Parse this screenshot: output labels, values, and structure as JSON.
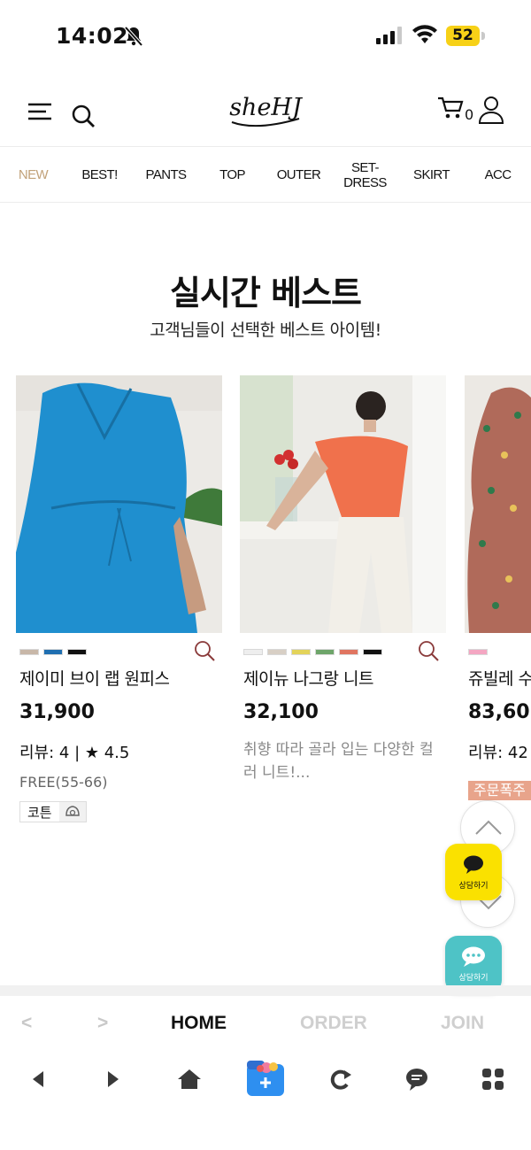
{
  "status_bar": {
    "time": "14:02",
    "battery": "52",
    "battery_color": "#f7d117"
  },
  "header": {
    "logo_text": "sheHJ",
    "cart_count": "0",
    "icons": [
      "menu-icon",
      "search-icon",
      "cart-icon",
      "user-icon"
    ]
  },
  "categories": [
    "NEW",
    "BEST!",
    "PANTS",
    "TOP",
    "OUTER",
    "SET-DRESS",
    "SKIRT",
    "ACC"
  ],
  "section": {
    "title": "실시간 베스트",
    "subtitle": "고객님들이 선택한 베스트 아이템!"
  },
  "products": [
    {
      "name": "제이미 브이 랩 원피스",
      "price": "31,900",
      "review": "리뷰: 4 | ★ 4.5",
      "size": "FREE(55-66)",
      "material": "코튼",
      "swatches": [
        "#c8b7a8",
        "#1f6fb1",
        "#111111"
      ]
    },
    {
      "name": "제이뉴 나그랑 니트",
      "price": "32,100",
      "description": "취향 따라 골라 입는 다양한 컬러 니트!...",
      "swatches": [
        "#eeeeee",
        "#d8cfc5",
        "#e3d35a",
        "#6ea56a",
        "#e07560",
        "#111111"
      ]
    },
    {
      "name": "쥬빌레 수",
      "price": "83,60",
      "review": "리뷰: 42",
      "badge": "주문폭주",
      "swatches": [
        "#f4a6c2"
      ]
    }
  ],
  "floating": {
    "kakao_label": "상담하기",
    "chat_label": "상담하기",
    "kakao_color": "#fae100",
    "chat_color": "#4ec3c6"
  },
  "tabbar": {
    "prev": "<",
    "next": ">",
    "home": "HOME",
    "order": "ORDER",
    "join": "JOIN"
  },
  "toolbar_icons": [
    "back-icon",
    "forward-icon",
    "home-icon",
    "new-tab-icon",
    "refresh-icon",
    "chat-icon",
    "apps-icon"
  ]
}
